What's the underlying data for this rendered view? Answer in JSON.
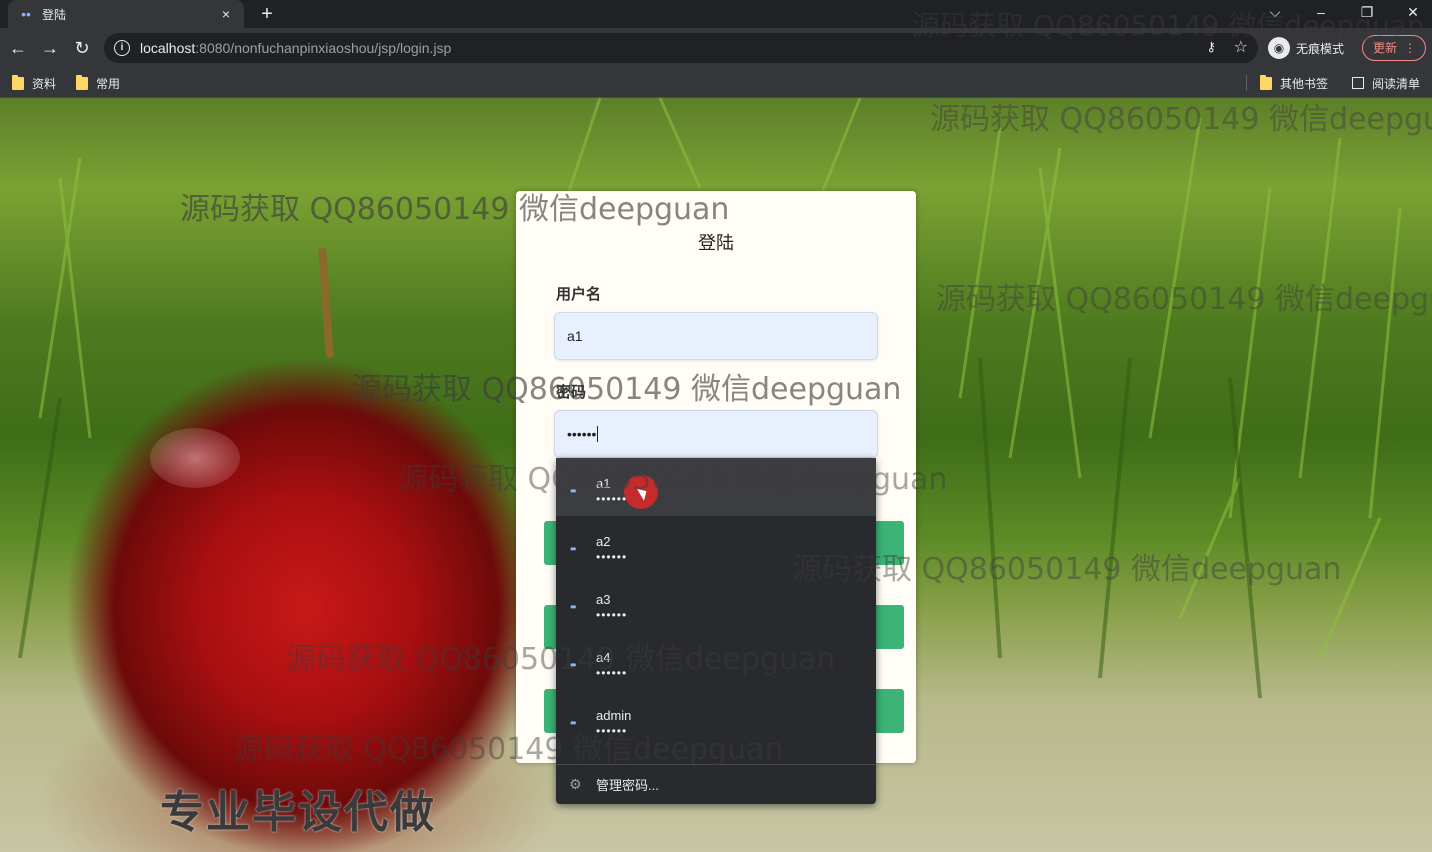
{
  "browser": {
    "tab_title": "登陆",
    "tab_close": "×",
    "new_tab": "+",
    "url_host": "localhost",
    "url_path": ":8080/nonfuchanpinxiaoshou/jsp/login.jsp",
    "incognito_label": "无痕模式",
    "update_label": "更新",
    "update_menu": "⋮",
    "bookmarks": [
      {
        "label": "资料"
      },
      {
        "label": "常用"
      }
    ],
    "other_bookmarks": "其他书签",
    "reading_list": "阅读清单",
    "window_controls": {
      "chevron": "⌵",
      "minimize": "–",
      "restore": "❐",
      "close": "✕"
    }
  },
  "login": {
    "title": "登陆",
    "username_label": "用户名",
    "username_value": "a1",
    "password_label": "密码",
    "password_value": "••••••"
  },
  "autofill": {
    "items": [
      {
        "user": "a1",
        "pass": "••••••"
      },
      {
        "user": "a2",
        "pass": "••••••"
      },
      {
        "user": "a3",
        "pass": "••••••"
      },
      {
        "user": "a4",
        "pass": "••••••"
      },
      {
        "user": "admin",
        "pass": "••••••"
      }
    ],
    "manage_label": "管理密码..."
  },
  "promo_text": "专业毕设代做",
  "watermark_text": "源码获取 QQ86050149 微信deepguan",
  "icons": {
    "key": "key-icon",
    "gear": "gear-icon",
    "star": "star-icon",
    "incognito": "incognito-icon"
  },
  "colors": {
    "accent_green": "#3bb475",
    "autofill_bg": "#292a2d",
    "field_bg": "#e8f0fe",
    "chrome_bg": "#35363a"
  }
}
